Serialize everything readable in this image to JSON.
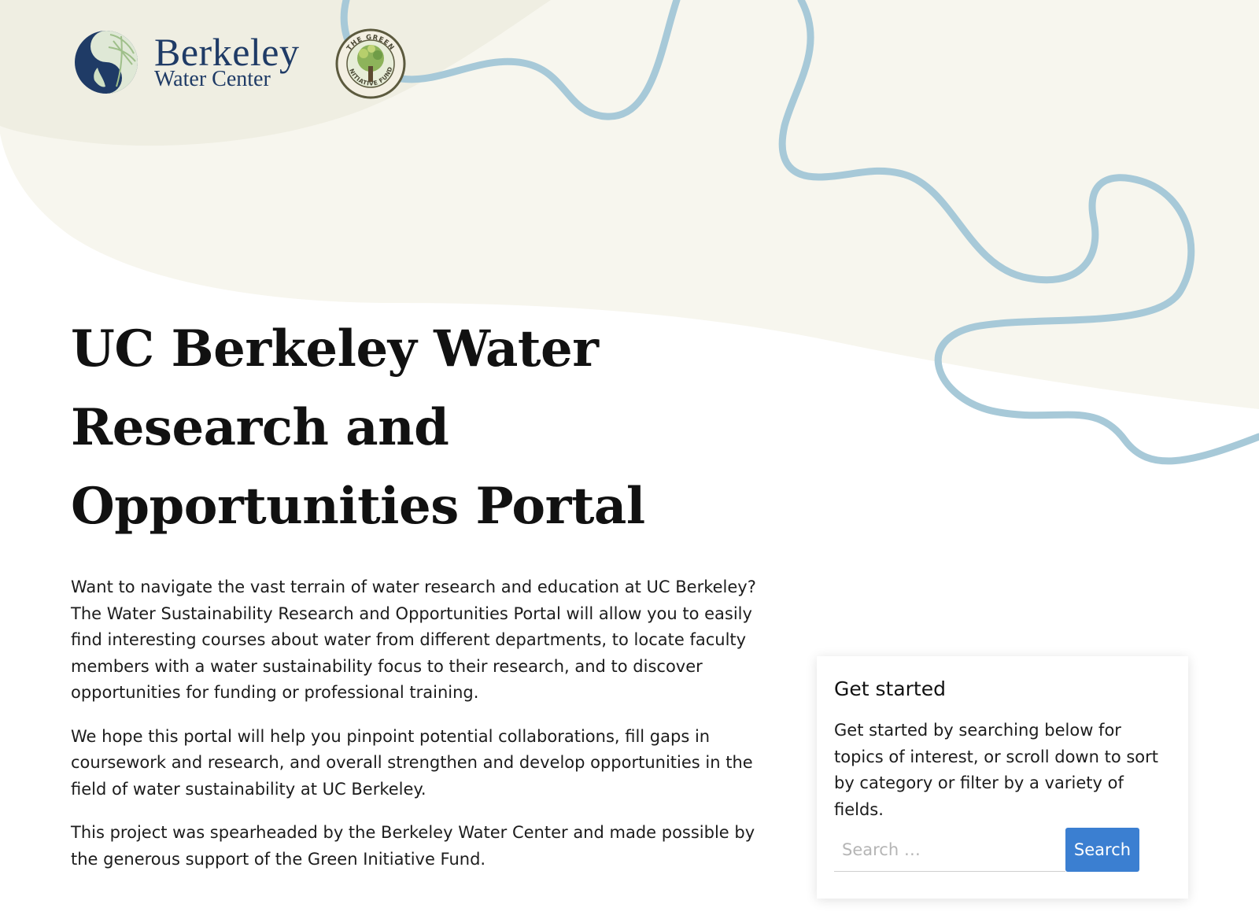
{
  "header": {
    "logo_primary": {
      "line1": "Berkeley",
      "line2": "Water Center",
      "icon": "berkeley-water-center-logo"
    },
    "logo_secondary": {
      "text": "THE GREEN INITIATIVE FUND",
      "icon": "green-initiative-fund-seal"
    }
  },
  "hero": {
    "title_line1": "UC Berkeley Water",
    "title_line2": "Research and",
    "title_line3": "Opportunities Portal"
  },
  "intro": {
    "p1": "Want to navigate the vast terrain of water research and education at UC Berkeley? The Water Sustainability Research and Opportunities Portal will allow you to easily find interesting courses about water from different departments, to locate faculty members with a water sustainability focus to their research, and to discover opportunities for funding or professional training.",
    "p2": "We hope this portal will help you pinpoint potential collaborations, fill gaps in coursework and research, and overall strengthen and develop opportunities in the field of water sustainability at UC Berkeley.",
    "p3": "This project was spearheaded by the Berkeley Water Center and made possible by the generous support of the Green Initiative Fund."
  },
  "get_started": {
    "title": "Get started",
    "text": "Get started by searching below for topics of interest, or scroll down to sort by category or filter by a variety of fields.",
    "search_placeholder": "Search …",
    "search_button": "Search"
  },
  "colors": {
    "cream": "#f7f6ee",
    "cream_dark": "#efeee2",
    "river": "#a7c9d8",
    "button": "#3b7fd1",
    "logo_navy": "#1f3b66"
  }
}
